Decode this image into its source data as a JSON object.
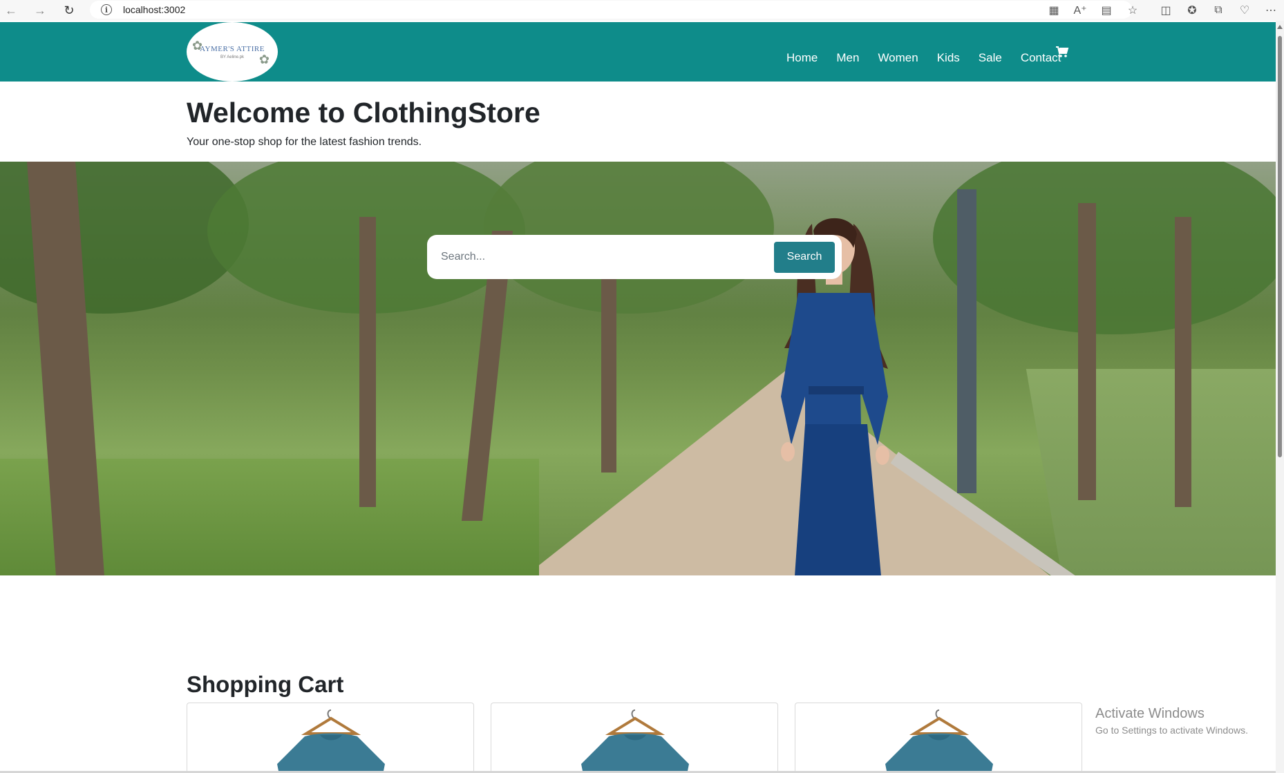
{
  "browser": {
    "url": "localhost:3002",
    "icons": [
      "back-icon",
      "forward-icon",
      "refresh-icon",
      "info-icon",
      "app-available-icon",
      "read-aloud-icon",
      "immersive-reader-icon",
      "favorite-star-icon",
      "split-screen-icon",
      "favorites-icon",
      "collections-icon",
      "browser-essentials-icon",
      "more-icon"
    ]
  },
  "navbar": {
    "logo_text": "AYMER'S ATTIRE",
    "logo_sub": "BY Aeline.pk",
    "links": [
      "Home",
      "Men",
      "Women",
      "Kids",
      "Sale",
      "Contact"
    ],
    "cart_icon": "shopping-cart-icon",
    "background": "#0e8c8a"
  },
  "welcome": {
    "title": "Welcome to ClothingStore",
    "subtitle": "Your one-stop shop for the latest fashion trends."
  },
  "search": {
    "placeholder": "Search...",
    "button_label": "Search",
    "button_color": "#227e8a"
  },
  "cart": {
    "title": "Shopping Cart",
    "items_visible": 3
  },
  "watermark": {
    "title": "Activate Windows",
    "subtitle": "Go to Settings to activate Windows."
  }
}
